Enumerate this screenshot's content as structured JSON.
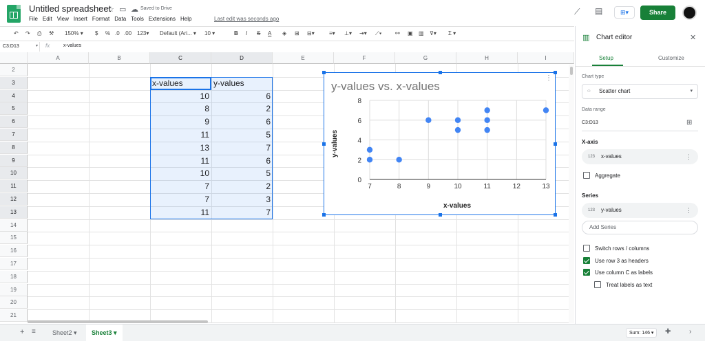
{
  "header": {
    "title": "Untitled spreadsheet",
    "saved": "Saved to Drive",
    "menu": [
      "File",
      "Edit",
      "View",
      "Insert",
      "Format",
      "Data",
      "Tools",
      "Extensions",
      "Help"
    ],
    "last_edit": "Last edit was seconds ago",
    "share": "Share"
  },
  "toolbar": {
    "zoom": "150%",
    "currency": "$",
    "percent": "%",
    "dec_less": ".0",
    "dec_more": ".00",
    "format_more": "123",
    "font": "Default (Ari...",
    "font_size": "10",
    "bold": "B",
    "italic": "I",
    "strike": "S",
    "text_color": "A"
  },
  "formula_bar": {
    "name_box": "C3:D13",
    "fx": "fx",
    "content": "x-values"
  },
  "grid": {
    "columns": [
      "A",
      "B",
      "C",
      "D",
      "E",
      "F",
      "G",
      "H",
      "I"
    ],
    "rows": [
      "2",
      "3",
      "4",
      "5",
      "6",
      "7",
      "8",
      "9",
      "10",
      "11",
      "12",
      "13",
      "14",
      "15",
      "16",
      "17",
      "18",
      "19",
      "20",
      "21"
    ],
    "headers": [
      "x-values",
      "y-values"
    ],
    "data": [
      [
        10,
        6
      ],
      [
        8,
        2
      ],
      [
        9,
        6
      ],
      [
        11,
        5
      ],
      [
        13,
        7
      ],
      [
        11,
        6
      ],
      [
        10,
        5
      ],
      [
        7,
        2
      ],
      [
        7,
        3
      ],
      [
        11,
        7
      ]
    ]
  },
  "chart_data": {
    "type": "scatter",
    "title": "y-values vs. x-values",
    "xlabel": "x-values",
    "ylabel": "y-values",
    "xlim": [
      7,
      13
    ],
    "ylim": [
      0,
      8
    ],
    "x_ticks": [
      "7",
      "8",
      "9",
      "10",
      "11",
      "12",
      "13"
    ],
    "y_ticks": [
      "0",
      "2",
      "4",
      "6",
      "8"
    ],
    "grid": true,
    "point_color": "#4285f4",
    "series": [
      {
        "points": [
          [
            10,
            6
          ],
          [
            8,
            2
          ],
          [
            9,
            6
          ],
          [
            11,
            5
          ],
          [
            13,
            7
          ],
          [
            11,
            6
          ],
          [
            10,
            5
          ],
          [
            7,
            2
          ],
          [
            7,
            3
          ],
          [
            11,
            7
          ]
        ]
      }
    ]
  },
  "bottom": {
    "sheets": [
      "Sheet2",
      "Sheet3"
    ],
    "active_sheet": "Sheet3",
    "sum": "Sum: 146"
  },
  "panel": {
    "title": "Chart editor",
    "tab_setup": "Setup",
    "tab_customize": "Customize",
    "chart_type_label": "Chart type",
    "chart_type": "Scatter chart",
    "data_range_label": "Data range",
    "data_range": "C3:D13",
    "xaxis_label": "X-axis",
    "xaxis_value": "x-values",
    "aggregate": "Aggregate",
    "series_label": "Series",
    "series_value": "y-values",
    "add_series": "Add Series",
    "switch_rows": "Switch rows / columns",
    "use_row_headers": "Use row 3 as headers",
    "use_col_labels": "Use column C as labels",
    "treat_labels": "Treat labels as text"
  },
  "colors": {
    "share_green": "#188038",
    "selection_blue": "#1a73e8",
    "point_blue": "#4285f4"
  }
}
